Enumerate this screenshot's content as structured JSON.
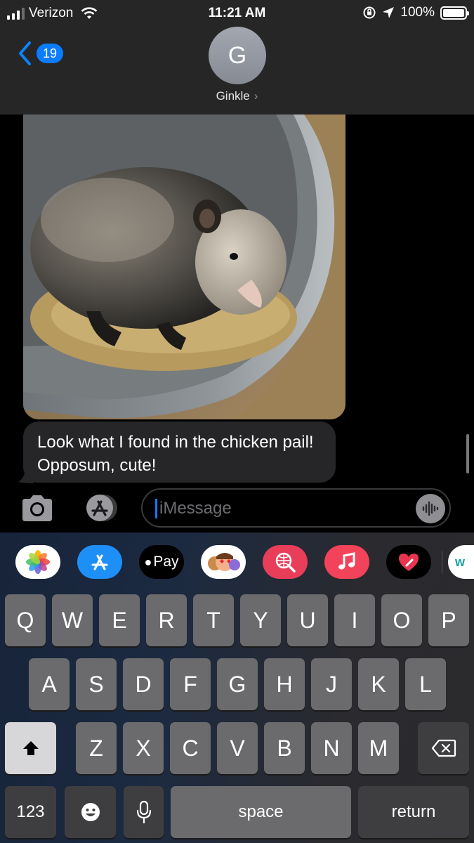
{
  "status_bar": {
    "carrier": "Verizon",
    "time": "11:21 AM",
    "battery": "100%"
  },
  "header": {
    "back_badge": "19",
    "avatar_initial": "G",
    "contact_name": "Ginkle",
    "contact_chevron": "›"
  },
  "messages": [
    {
      "type": "image",
      "description_icon": "photo-attachment"
    },
    {
      "type": "text",
      "text": "Look what I found in the chicken pail! Opposum, cute!"
    }
  ],
  "composer": {
    "placeholder": "iMessage"
  },
  "app_drawer": [
    {
      "name": "photos",
      "label": ""
    },
    {
      "name": "app-store",
      "label": ""
    },
    {
      "name": "apple-pay",
      "label": "Pay"
    },
    {
      "name": "memoji",
      "label": ""
    },
    {
      "name": "images-search",
      "label": ""
    },
    {
      "name": "music",
      "label": ""
    },
    {
      "name": "digital-touch",
      "label": ""
    },
    {
      "name": "amazon",
      "label": "w"
    }
  ],
  "keyboard": {
    "row1": [
      "Q",
      "W",
      "E",
      "R",
      "T",
      "Y",
      "U",
      "I",
      "O",
      "P"
    ],
    "row2": [
      "A",
      "S",
      "D",
      "F",
      "G",
      "H",
      "J",
      "K",
      "L"
    ],
    "row3": [
      "Z",
      "X",
      "C",
      "V",
      "B",
      "N",
      "M"
    ],
    "numbers": "123",
    "space": "space",
    "return": "return"
  }
}
